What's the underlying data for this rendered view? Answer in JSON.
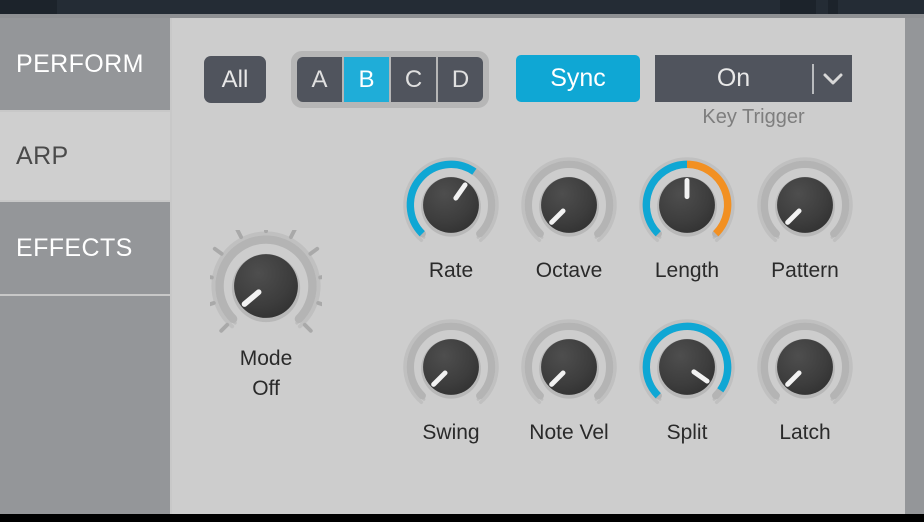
{
  "window": {
    "title_bar_color": "#242c35",
    "panel_bg": "#cdcdcd",
    "accent_cyan": "#0fa7d4",
    "accent_orange": "#f29022",
    "control_dark": "#50545d"
  },
  "sidebar": {
    "items": [
      {
        "label": "PERFORM",
        "active": false
      },
      {
        "label": "ARP",
        "active": true
      },
      {
        "label": "EFFECTS",
        "active": false
      }
    ]
  },
  "toolbar": {
    "all_button": "All",
    "segments": [
      {
        "label": "A",
        "selected": false
      },
      {
        "label": "B",
        "selected": true
      },
      {
        "label": "C",
        "selected": false
      },
      {
        "label": "D",
        "selected": false
      }
    ],
    "sync_button": "Sync",
    "key_trigger": {
      "value": "On",
      "caption": "Key Trigger",
      "chevron": "chevron-down-icon"
    }
  },
  "mode_knob": {
    "label": "Mode",
    "value_label": "Off",
    "angle_deg": -130,
    "type": "stepped",
    "arc_color": "#b0b0b0"
  },
  "knob_rows": [
    [
      {
        "label": "Rate",
        "angle_deg": 35,
        "cyan_to": 35,
        "orange": false
      },
      {
        "label": "Octave",
        "angle_deg": -135,
        "cyan_to": null,
        "orange": false
      },
      {
        "label": "Length",
        "angle_deg": 0,
        "cyan_to": 0,
        "orange": true
      },
      {
        "label": "Pattern",
        "angle_deg": -135,
        "cyan_to": null,
        "orange": false
      }
    ],
    [
      {
        "label": "Swing",
        "angle_deg": -135,
        "cyan_to": null,
        "orange": false
      },
      {
        "label": "Note Vel",
        "angle_deg": -135,
        "cyan_to": null,
        "orange": false
      },
      {
        "label": "Split",
        "angle_deg": 125,
        "cyan_to": 125,
        "orange": false
      },
      {
        "label": "Latch",
        "angle_deg": -135,
        "cyan_to": null,
        "orange": false
      }
    ]
  ]
}
